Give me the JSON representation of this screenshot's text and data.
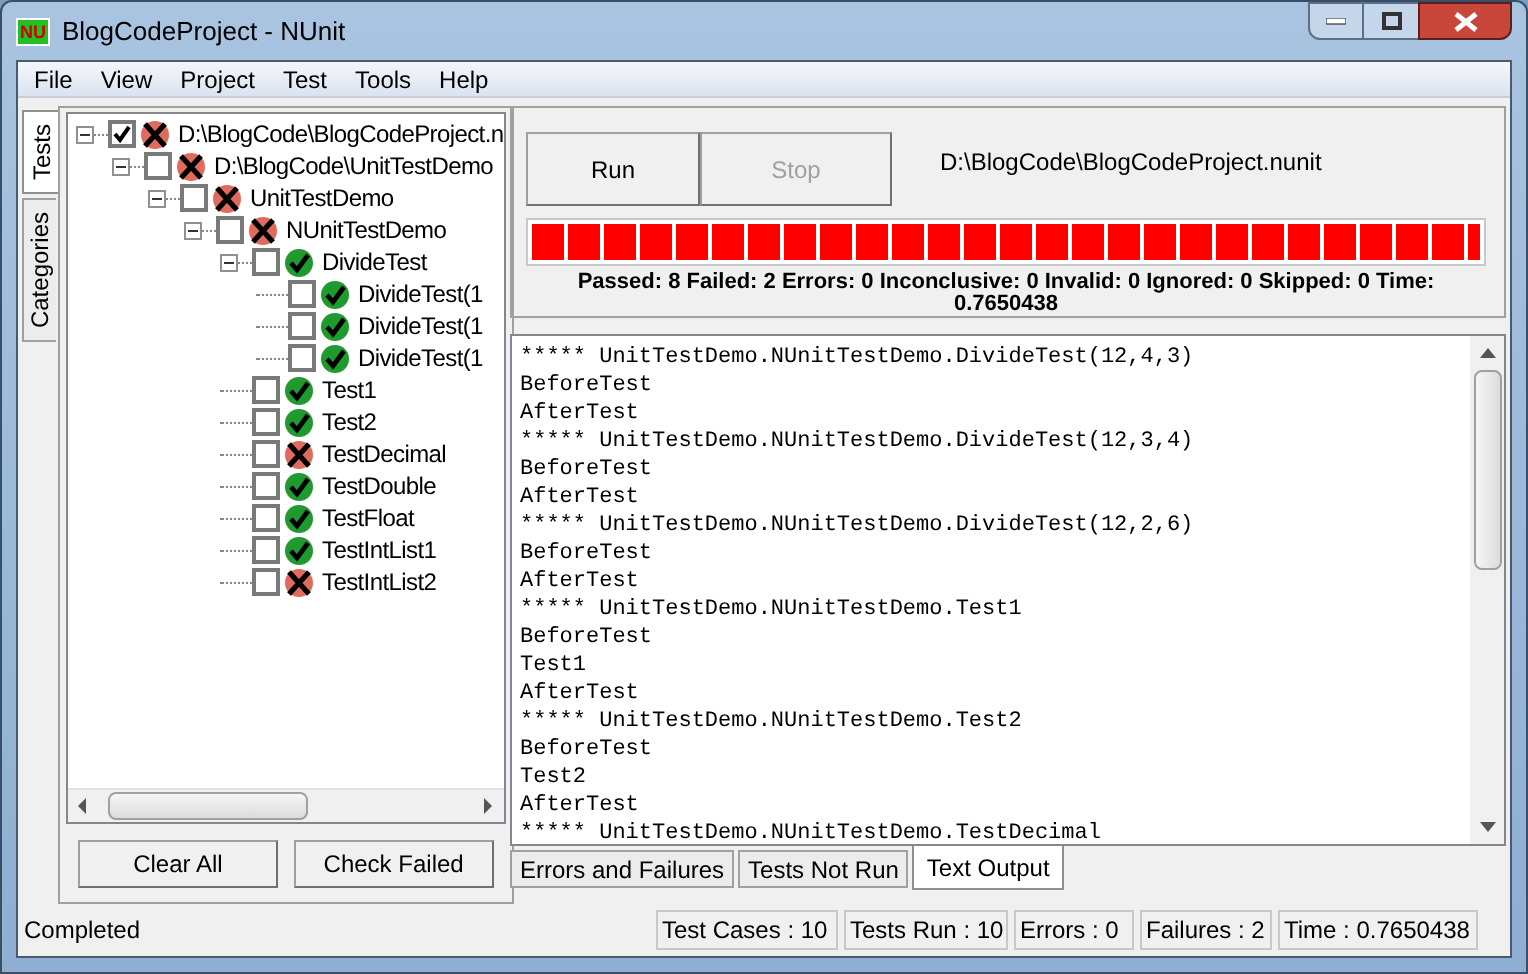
{
  "window": {
    "logo": "NU",
    "title": "BlogCodeProject - NUnit"
  },
  "menu": [
    "File",
    "View",
    "Project",
    "Test",
    "Tools",
    "Help"
  ],
  "side_tabs": [
    {
      "label": "Tests",
      "selected": true
    },
    {
      "label": "Categories",
      "selected": false
    }
  ],
  "tree": [
    {
      "label": "D:\\BlogCode\\BlogCodeProject.n",
      "checked": true,
      "passed": false,
      "expanded": true,
      "children": [
        {
          "label": "D:\\BlogCode\\UnitTestDemo",
          "checked": false,
          "passed": false,
          "expanded": true,
          "children": [
            {
              "label": "UnitTestDemo",
              "checked": false,
              "passed": false,
              "expanded": true,
              "children": [
                {
                  "label": "NUnitTestDemo",
                  "checked": false,
                  "passed": false,
                  "expanded": true,
                  "children": [
                    {
                      "label": "DivideTest",
                      "checked": false,
                      "passed": true,
                      "expanded": true,
                      "children": [
                        {
                          "label": "DivideTest(1",
                          "checked": false,
                          "passed": true
                        },
                        {
                          "label": "DivideTest(1",
                          "checked": false,
                          "passed": true
                        },
                        {
                          "label": "DivideTest(1",
                          "checked": false,
                          "passed": true
                        }
                      ]
                    },
                    {
                      "label": "Test1",
                      "checked": false,
                      "passed": true
                    },
                    {
                      "label": "Test2",
                      "checked": false,
                      "passed": true
                    },
                    {
                      "label": "TestDecimal",
                      "checked": false,
                      "passed": false
                    },
                    {
                      "label": "TestDouble",
                      "checked": false,
                      "passed": true
                    },
                    {
                      "label": "TestFloat",
                      "checked": false,
                      "passed": true
                    },
                    {
                      "label": "TestIntList1",
                      "checked": false,
                      "passed": true
                    },
                    {
                      "label": "TestIntList2",
                      "checked": false,
                      "passed": false
                    }
                  ]
                }
              ]
            }
          ]
        }
      ]
    }
  ],
  "tree_buttons": [
    "Clear All",
    "Check Failed"
  ],
  "run_button": {
    "label": "Run",
    "disabled": false
  },
  "stop_button": {
    "label": "Stop",
    "disabled": true
  },
  "project_path": "D:\\BlogCode\\BlogCodeProject.nunit",
  "progress": {
    "level": 1,
    "passed": false
  },
  "summary": "Passed: 8 Failed: 2 Errors: 0 Inconclusive: 0 Invalid: 0 Ignored: 0 Skipped: 0 Time: 0.7650438",
  "output_lines": [
    "***** UnitTestDemo.NUnitTestDemo.DivideTest(12,4,3)",
    "BeforeTest",
    "AfterTest",
    "***** UnitTestDemo.NUnitTestDemo.DivideTest(12,3,4)",
    "BeforeTest",
    "AfterTest",
    "***** UnitTestDemo.NUnitTestDemo.DivideTest(12,2,6)",
    "BeforeTest",
    "AfterTest",
    "***** UnitTestDemo.NUnitTestDemo.Test1",
    "BeforeTest",
    "Test1",
    "AfterTest",
    "***** UnitTestDemo.NUnitTestDemo.Test2",
    "BeforeTest",
    "Test2",
    "AfterTest",
    "***** UnitTestDemo.NUnitTestDemo.TestDecimal"
  ],
  "result_tabs": [
    {
      "label": "Errors and Failures",
      "selected": false
    },
    {
      "label": "Tests Not Run",
      "selected": false
    },
    {
      "label": "Text Output",
      "selected": true
    }
  ],
  "status_bar": {
    "message": "Completed",
    "panels": [
      "Test Cases : 10",
      "Tests Run : 10",
      "Errors : 0",
      "Failures : 2",
      "Time : 0.7650438"
    ]
  }
}
